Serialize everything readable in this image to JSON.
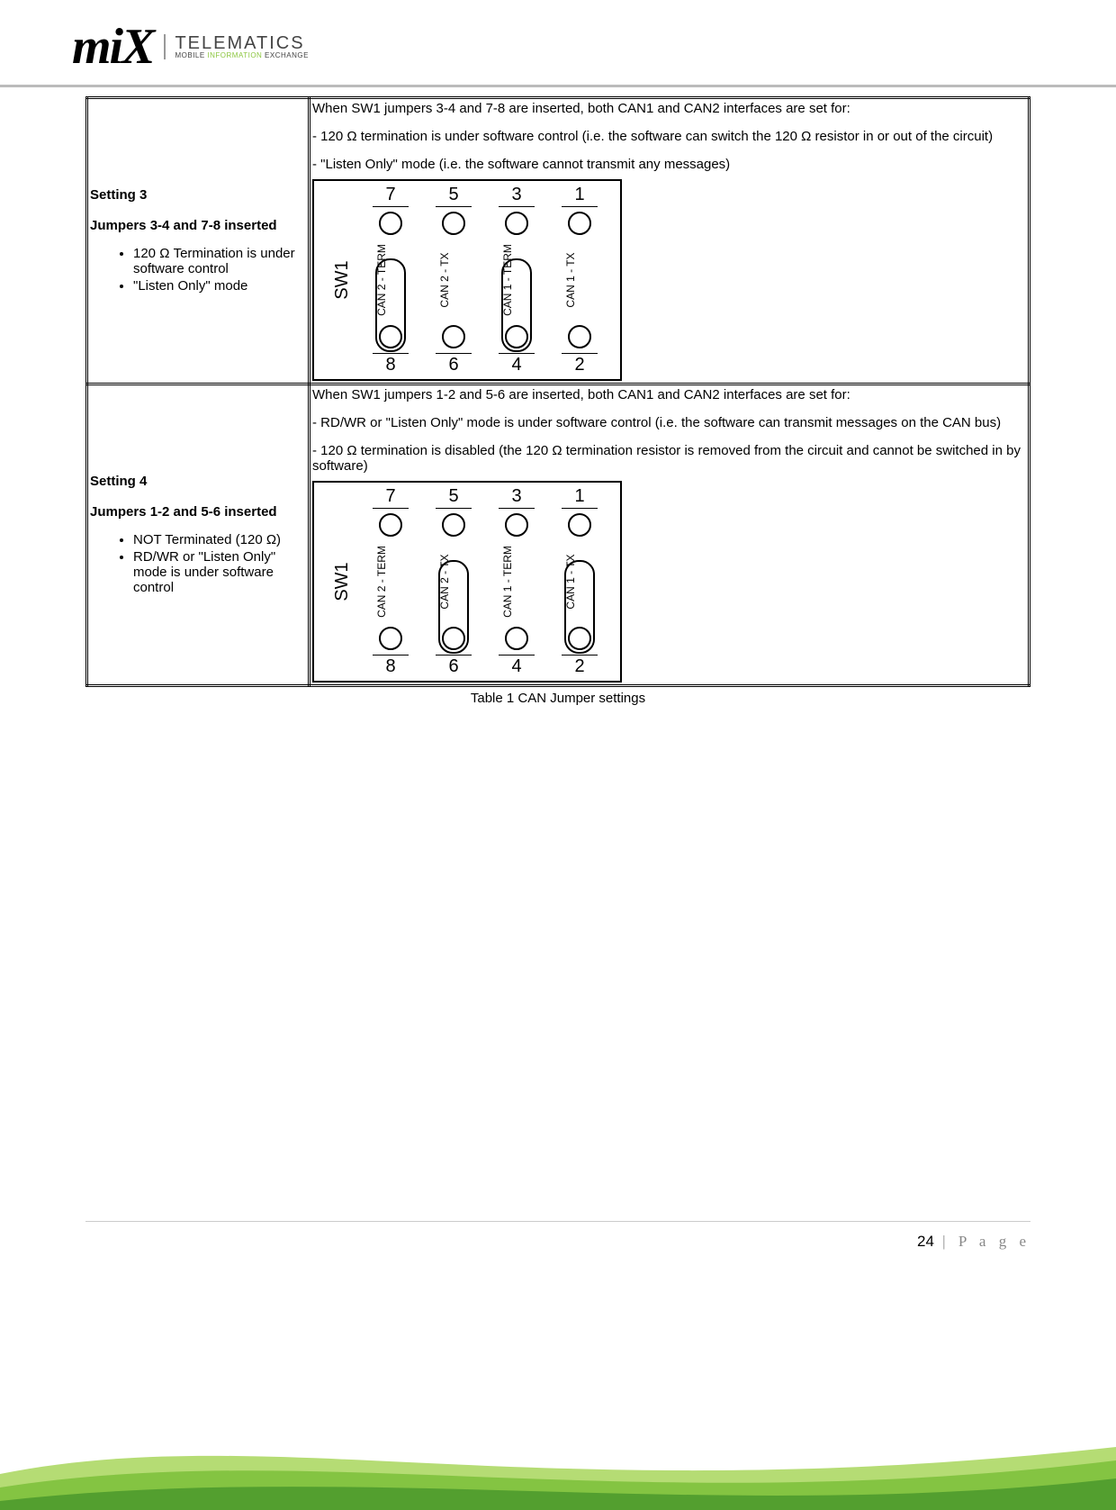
{
  "header": {
    "logo_text": "miX",
    "brand_title": "TELEMATICS",
    "brand_sub_1": "MOBILE ",
    "brand_sub_2": "INFORMATION",
    "brand_sub_3": " EXCHANGE"
  },
  "table": {
    "rows": [
      {
        "setting_title": "Setting 3",
        "setting_sub": "Jumpers 3-4 and 7-8 inserted",
        "bullets": [
          "120 Ω Termination is under software control",
          "\"Listen Only\" mode"
        ],
        "desc_intro": "When SW1 jumpers 3-4 and 7-8 are inserted, both CAN1 and CAN2 interfaces are set for:",
        "desc_point1": "- 120 Ω termination is under software control (i.e. the software can switch the 120 Ω resistor in or out of the circuit)",
        "desc_point2": "- \"Listen Only\" mode (i.e. the software cannot transmit any messages)",
        "diagram": {
          "sw_label": "SW1",
          "columns": [
            {
              "top": "7",
              "bot": "8",
              "label": "CAN 2 - TERM",
              "jumper": "bot"
            },
            {
              "top": "5",
              "bot": "6",
              "label": "CAN 2 - TX",
              "jumper": null
            },
            {
              "top": "3",
              "bot": "4",
              "label": "CAN 1 - TERM",
              "jumper": "bot"
            },
            {
              "top": "1",
              "bot": "2",
              "label": "CAN 1 - TX",
              "jumper": null
            }
          ]
        }
      },
      {
        "setting_title": "Setting 4",
        "setting_sub": "Jumpers 1-2 and 5-6 inserted",
        "bullets": [
          "NOT Terminated (120 Ω)",
          "RD/WR or \"Listen Only\" mode is under software control"
        ],
        "desc_intro": "When SW1 jumpers 1-2 and 5-6 are inserted, both CAN1 and CAN2 interfaces are set for:",
        "desc_point1": "- RD/WR or \"Listen Only\" mode is under software control (i.e. the software can transmit messages on the CAN bus)",
        "desc_point2": "- 120 Ω termination is disabled (the 120 Ω termination resistor is removed from the circuit and cannot be switched in by software)",
        "diagram": {
          "sw_label": "SW1",
          "columns": [
            {
              "top": "7",
              "bot": "8",
              "label": "CAN 2 - TERM",
              "jumper": null
            },
            {
              "top": "5",
              "bot": "6",
              "label": "CAN 2 - TX",
              "jumper": "bot"
            },
            {
              "top": "3",
              "bot": "4",
              "label": "CAN 1 - TERM",
              "jumper": null
            },
            {
              "top": "1",
              "bot": "2",
              "label": "CAN 1 - TX",
              "jumper": "bot"
            }
          ]
        }
      }
    ],
    "caption": "Table 1 CAN Jumper settings"
  },
  "footer": {
    "page_number": "24",
    "page_label": " | P a g e"
  }
}
